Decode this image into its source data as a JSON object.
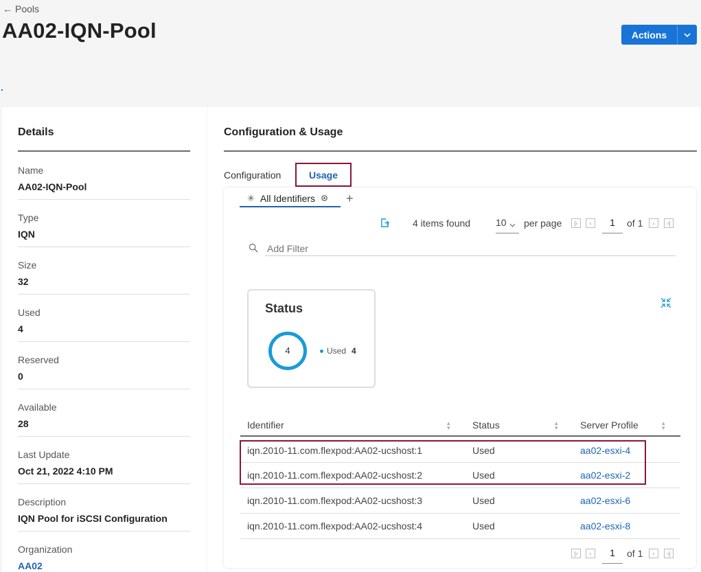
{
  "header": {
    "back_label": "Pools",
    "title": "AA02-IQN-Pool",
    "actions_label": "Actions"
  },
  "details": {
    "title": "Details",
    "fields": [
      {
        "label": "Name",
        "value": "AA02-IQN-Pool"
      },
      {
        "label": "Type",
        "value": "IQN"
      },
      {
        "label": "Size",
        "value": "32"
      },
      {
        "label": "Used",
        "value": "4"
      },
      {
        "label": "Reserved",
        "value": "0"
      },
      {
        "label": "Available",
        "value": "28"
      },
      {
        "label": "Last Update",
        "value": "Oct 21, 2022 4:10 PM"
      },
      {
        "label": "Description",
        "value": "IQN Pool for iSCSI Configuration"
      },
      {
        "label": "Organization",
        "value": "AA02"
      }
    ]
  },
  "config_usage": {
    "title": "Configuration & Usage",
    "tabs": [
      "Configuration",
      "Usage"
    ],
    "active_tab": "Usage",
    "subtab_label": "All Identifiers",
    "items_found": "4 items found",
    "per_page_value": "10",
    "per_page_label": "per page",
    "page_current": "1",
    "page_of": "of 1",
    "filter_placeholder": "Add Filter"
  },
  "status_widget": {
    "title": "Status",
    "total": "4",
    "legend_label": "Used",
    "legend_value": "4",
    "color": "#1a9bd7"
  },
  "table": {
    "columns": [
      "Identifier",
      "Status",
      "Server Profile"
    ],
    "rows": [
      {
        "identifier": "iqn.2010-11.com.flexpod:AA02-ucshost:1",
        "status": "Used",
        "profile": "aa02-esxi-4"
      },
      {
        "identifier": "iqn.2010-11.com.flexpod:AA02-ucshost:2",
        "status": "Used",
        "profile": "aa02-esxi-2"
      },
      {
        "identifier": "iqn.2010-11.com.flexpod:AA02-ucshost:3",
        "status": "Used",
        "profile": "aa02-esxi-6"
      },
      {
        "identifier": "iqn.2010-11.com.flexpod:AA02-ucshost:4",
        "status": "Used",
        "profile": "aa02-esxi-8"
      }
    ],
    "page_current": "1",
    "page_of": "of 1"
  },
  "colors": {
    "accent": "#1874d6",
    "highlight_border": "#8a1538",
    "link": "#1d64b6"
  }
}
